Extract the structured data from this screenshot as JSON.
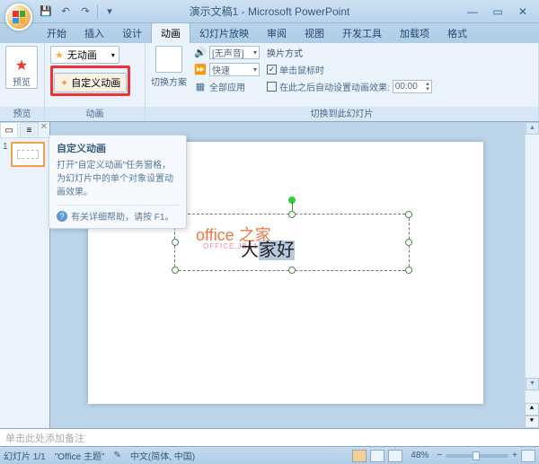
{
  "window": {
    "title": "演示文稿1 - Microsoft PowerPoint",
    "qat": {
      "save": "💾",
      "undo": "↶",
      "redo": "↷",
      "more": "▾"
    }
  },
  "tabs": {
    "start": "开始",
    "insert": "插入",
    "design": "设计",
    "animation": "动画",
    "slideshow": "幻灯片放映",
    "review": "审阅",
    "view": "视图",
    "developer": "开发工具",
    "addins": "加载项",
    "format": "格式"
  },
  "ribbon": {
    "preview": {
      "label": "预览",
      "btn": "预览"
    },
    "animation": {
      "label": "动画",
      "dropdown": "无动画",
      "custom_btn": "自定义动画"
    },
    "transition": {
      "label": "切换到此幻灯片",
      "scheme_label": "切换方案",
      "sound_label": "[无声音]",
      "speed_label": "快速",
      "applyall_label": "全部应用"
    },
    "advance": {
      "title": "换片方式",
      "onclick": "单击鼠标时",
      "auto": "在此之后自动设置动画效果:",
      "time": "00:00"
    }
  },
  "tooltip": {
    "title": "自定义动画",
    "body": "打开\"自定义动画\"任务窗格，为幻灯片中的单个对象设置动画效果。",
    "help": "有关详细帮助，请按 F1。"
  },
  "slide": {
    "watermark": "office 之家",
    "watermark_sub": "OFFICE.JBS1.NET",
    "text_plain": "大",
    "text_selected": "家好"
  },
  "thumbnail": {
    "num": "1"
  },
  "notes": {
    "placeholder": "单击此处添加备注"
  },
  "status": {
    "slide_pos": "幻灯片 1/1",
    "theme": "\"Office 主题\"",
    "lang": "中文(简体, 中国)",
    "zoom": "48%",
    "minus": "−",
    "plus": "+"
  }
}
